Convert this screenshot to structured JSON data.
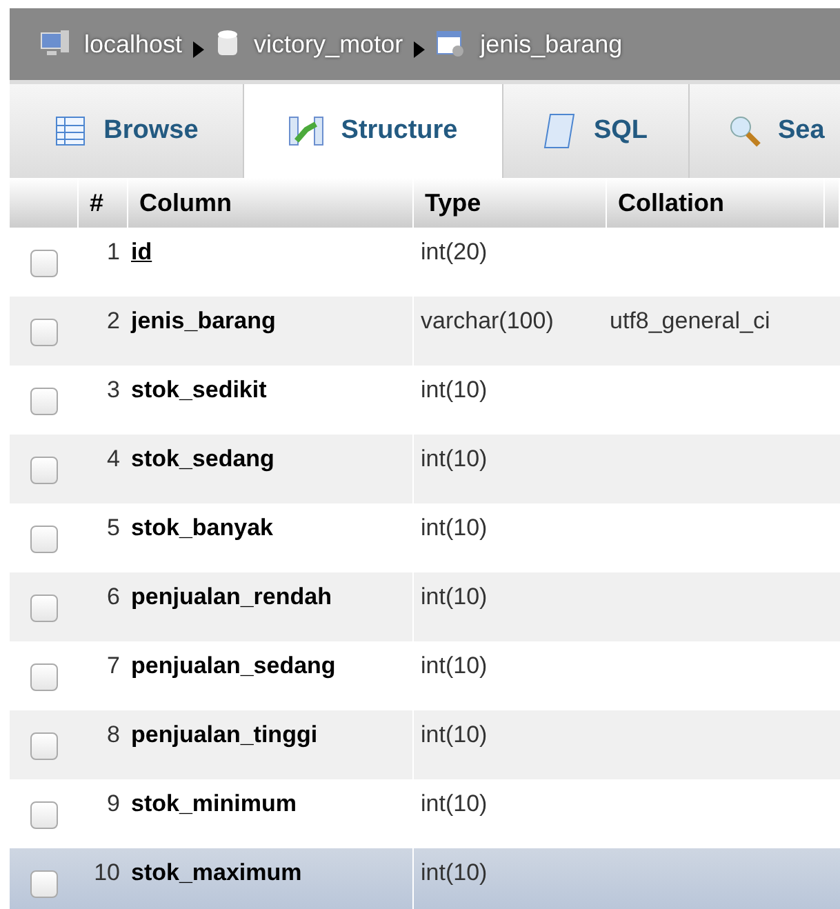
{
  "breadcrumb": [
    {
      "kind": "server",
      "label": "localhost"
    },
    {
      "kind": "database",
      "label": "victory_motor"
    },
    {
      "kind": "table",
      "label": "jenis_barang"
    }
  ],
  "tabs": [
    {
      "kind": "browse",
      "label": "Browse",
      "selected": false
    },
    {
      "kind": "structure",
      "label": "Structure",
      "selected": true
    },
    {
      "kind": "sql",
      "label": "SQL",
      "selected": false
    },
    {
      "kind": "search",
      "label": "Sea",
      "selected": false
    }
  ],
  "table": {
    "columns": [
      "#",
      "Column",
      "Type",
      "Collation"
    ],
    "rows": [
      {
        "num": "1",
        "name": "id",
        "type": "int(20)",
        "primary": true,
        "checked": false,
        "highlighted": false
      },
      {
        "num": "2",
        "name": "jenis_barang",
        "type": "varchar(100)",
        "collation": "utf8_general_ci",
        "primary": false,
        "checked": false,
        "highlighted": false
      },
      {
        "num": "3",
        "name": "stok_sedikit",
        "type": "int(10)",
        "primary": false,
        "checked": false,
        "highlighted": false
      },
      {
        "num": "4",
        "name": "stok_sedang",
        "type": "int(10)",
        "primary": false,
        "checked": false,
        "highlighted": false
      },
      {
        "num": "5",
        "name": "stok_banyak",
        "type": "int(10)",
        "primary": false,
        "checked": false,
        "highlighted": false
      },
      {
        "num": "6",
        "name": "penjualan_rendah",
        "type": "int(10)",
        "primary": false,
        "checked": false,
        "highlighted": false
      },
      {
        "num": "7",
        "name": "penjualan_sedang",
        "type": "int(10)",
        "primary": false,
        "checked": false,
        "highlighted": false
      },
      {
        "num": "8",
        "name": "penjualan_tinggi",
        "type": "int(10)",
        "primary": false,
        "checked": false,
        "highlighted": false
      },
      {
        "num": "9",
        "name": "stok_minimum",
        "type": "int(10)",
        "primary": false,
        "checked": false,
        "highlighted": false
      },
      {
        "num": "10",
        "name": "stok_maximum",
        "type": "int(10)",
        "primary": false,
        "checked": false,
        "highlighted": true
      }
    ]
  }
}
